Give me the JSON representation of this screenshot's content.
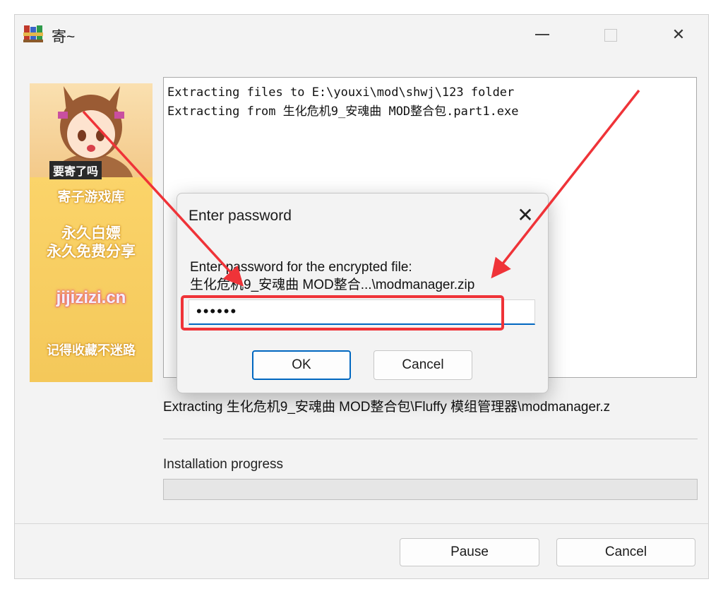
{
  "window": {
    "title": "寄~",
    "icon": "winrar-books-icon"
  },
  "banner": {
    "caption": "要寄了吗",
    "line1": "寄子游戏库",
    "line2a": "永久白嫖",
    "line2b": "永久免费分享",
    "site": "jijizizi.cn",
    "line4": "记得收藏不迷路"
  },
  "log": {
    "lines": [
      "Extracting files to E:\\youxi\\mod\\shwj\\123 folder",
      "Extracting from 生化危机9_安魂曲 MOD整合包.part1.exe"
    ]
  },
  "status_text": "Extracting 生化危机9_安魂曲 MOD整合包\\Fluffy 模组管理器\\modmanager.z",
  "progress": {
    "label": "Installation progress",
    "value": 0
  },
  "buttons": {
    "pause": "Pause",
    "cancel": "Cancel"
  },
  "dialog": {
    "title": "Enter password",
    "prompt": "Enter password for the encrypted file:",
    "file": "生化危机9_安魂曲 MOD整合...\\modmanager.zip",
    "password_mask": "••••••",
    "ok": "OK",
    "cancel": "Cancel"
  },
  "colors": {
    "annotation_red": "#ef3338",
    "focus_blue": "#0067c0"
  }
}
